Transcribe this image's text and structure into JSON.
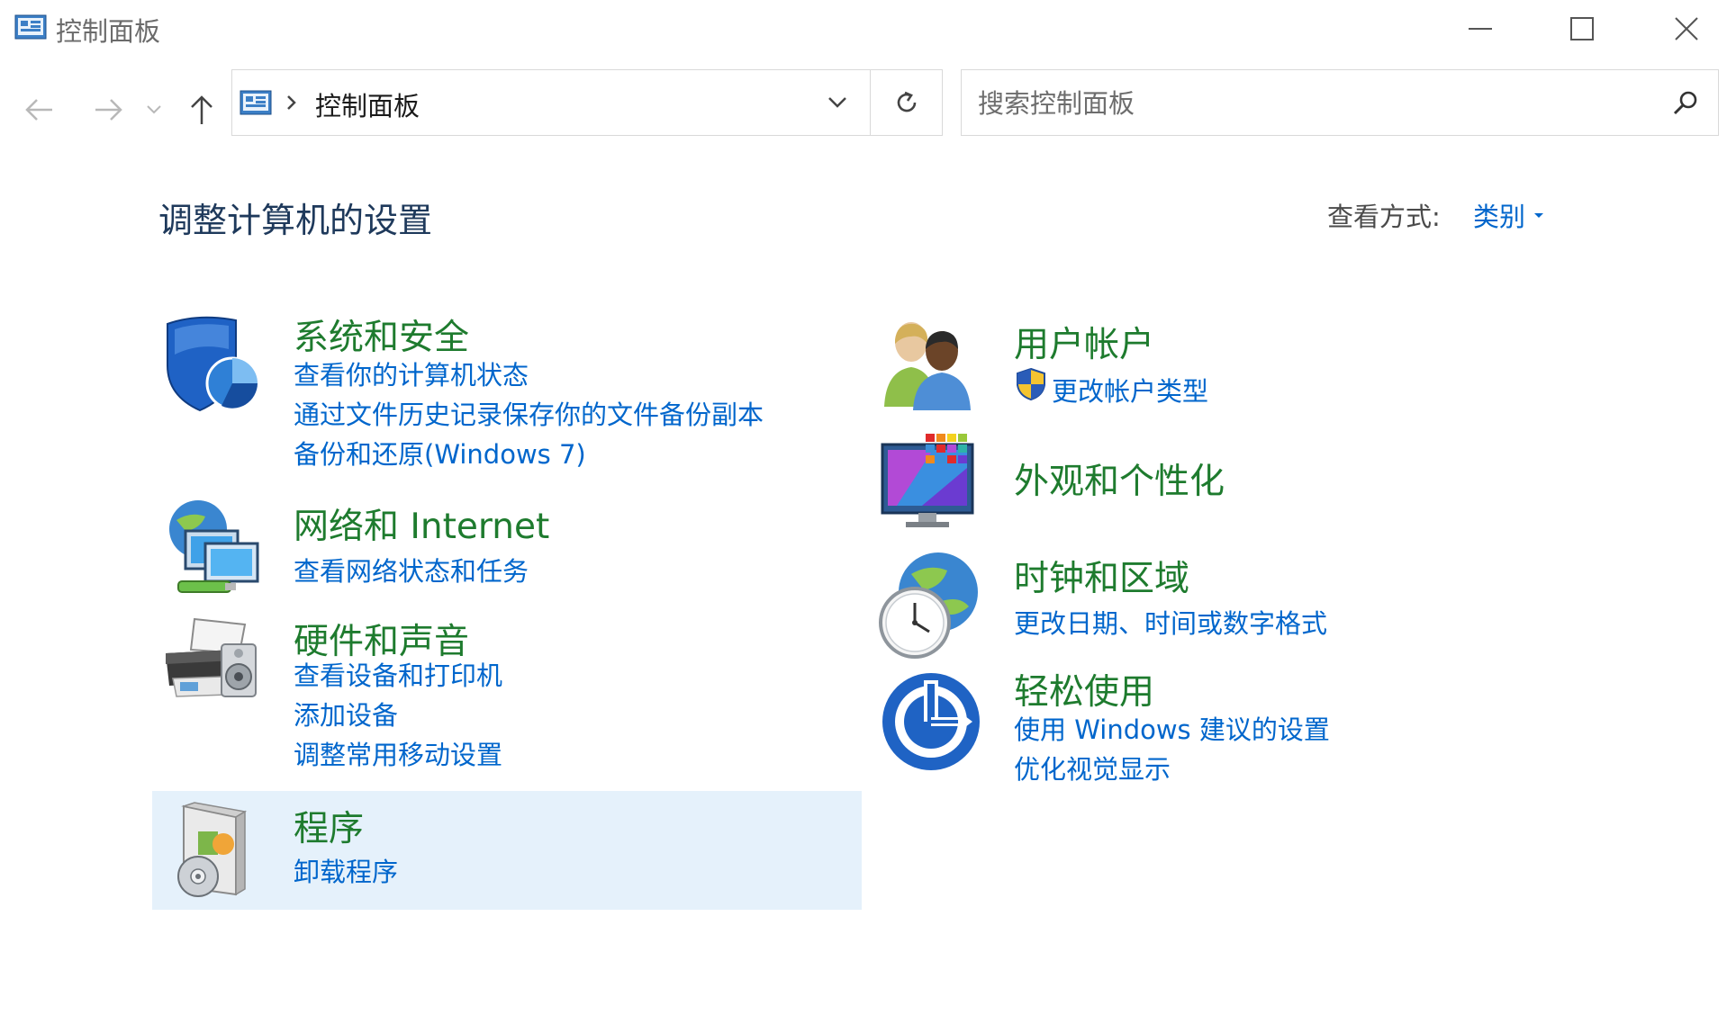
{
  "window": {
    "title": "控制面板",
    "colors": {
      "accent": "#0066cc",
      "category_title": "#1e7b2e",
      "heading": "#1e395b",
      "highlight": "#e5f1fb"
    }
  },
  "address_bar": {
    "breadcrumb": "控制面板"
  },
  "search": {
    "placeholder": "搜索控制面板"
  },
  "main": {
    "heading": "调整计算机的设置",
    "view_by_label": "查看方式:",
    "view_by_value": "类别",
    "categories": [
      {
        "title": "系统和安全",
        "icon": "shield-icon",
        "links": [
          "查看你的计算机状态",
          "通过文件历史记录保存你的文件备份副本",
          "备份和还原(Windows 7)"
        ]
      },
      {
        "title": "网络和 Internet",
        "icon": "network-icon",
        "links": [
          "查看网络状态和任务"
        ]
      },
      {
        "title": "硬件和声音",
        "icon": "printer-icon",
        "links": [
          "查看设备和打印机",
          "添加设备",
          "调整常用移动设置"
        ]
      },
      {
        "title": "程序",
        "icon": "programs-icon",
        "links": [
          "卸载程序"
        ],
        "highlighted": true
      },
      {
        "title": "用户帐户",
        "icon": "users-icon",
        "links": [
          "更改帐户类型"
        ]
      },
      {
        "title": "外观和个性化",
        "icon": "monitor-palette-icon",
        "links": []
      },
      {
        "title": "时钟和区域",
        "icon": "clock-globe-icon",
        "links": [
          "更改日期、时间或数字格式"
        ]
      },
      {
        "title": "轻松使用",
        "icon": "ease-of-access-icon",
        "links": [
          "使用 Windows 建议的设置",
          "优化视觉显示"
        ]
      }
    ]
  }
}
